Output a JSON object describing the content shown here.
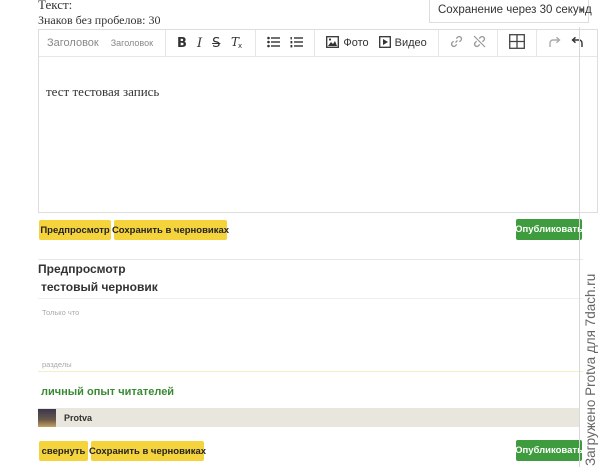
{
  "form": {
    "text_label": "Текст:",
    "char_count": "Знаков без пробелов: 30"
  },
  "autosave": {
    "label": "Сохранение через 30 секунд",
    "caret": "▾"
  },
  "toolbar": {
    "heading1": "Заголовок",
    "heading2": "Заголовок",
    "bold": "B",
    "italic": "I",
    "strike": "S",
    "clear_format": "Tx",
    "photo": "Фото",
    "video": "Видео"
  },
  "editor": {
    "content": "тест тестовая запись"
  },
  "actions_top": {
    "preview": "Предпросмотр",
    "save_draft": "Сохранить в черновиках",
    "publish": "Опубликовать"
  },
  "preview": {
    "heading": "Предпросмотр",
    "post_title": "тестовый черновик",
    "visibility": "Только что",
    "sections_label": "разделы",
    "section_link": "личный опыт читателей",
    "author": "Protva"
  },
  "actions_bottom": {
    "collapse": "свернуть",
    "save_draft": "Сохранить в черновиках",
    "publish": "Опубликовать"
  },
  "watermark": "Загружено Protva для 7dach.ru"
}
